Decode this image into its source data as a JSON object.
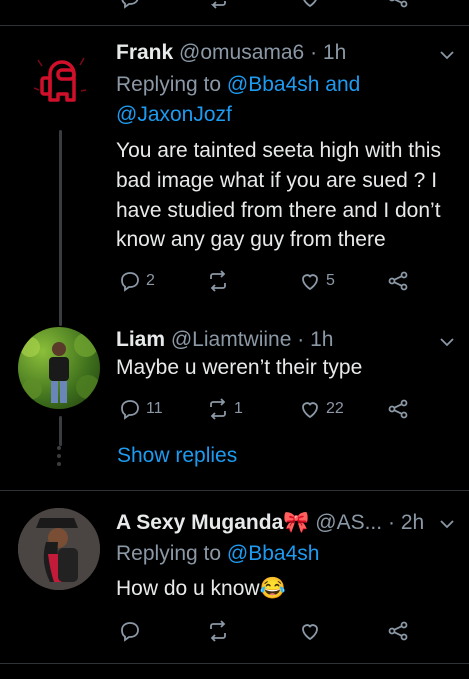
{
  "tweets": [
    {
      "name": "Frank",
      "handle": "@omusama6",
      "sep": "·",
      "time": "1h",
      "replying_prefix": "Replying to ",
      "replying_line1": "@Bba4sh and",
      "replying_line2": "@JaxonJozf",
      "text_lines": [
        "You are tainted seeta high with this",
        "bad image what if you are sued ? I",
        "have studied from there and I don’t",
        "know any gay guy from there"
      ],
      "replies": "2",
      "retweets": "",
      "likes": "5"
    },
    {
      "name": "Liam",
      "handle": "@Liamtwiine",
      "sep": "·",
      "time": "1h",
      "text_lines": [
        "Maybe u weren’t their type"
      ],
      "replies": "11",
      "retweets": "1",
      "likes": "22"
    },
    {
      "name": "A Sexy Muganda🎀",
      "handle": "@AS...",
      "sep": "·",
      "time": "2h",
      "replying_prefix": "Replying to ",
      "replying_line1": "@Bba4sh",
      "text_lines": [
        "How do u know😂"
      ],
      "replies": "",
      "retweets": "",
      "likes": ""
    }
  ],
  "show_replies": "Show replies",
  "icons": {
    "reply": "reply-icon",
    "retweet": "retweet-icon",
    "like": "heart-icon",
    "share": "share-icon",
    "more": "chevron-down-icon"
  },
  "colors": {
    "background": "#000000",
    "link": "#1d9bf0",
    "muted": "#8b98a5",
    "text": "#e7e9ea"
  }
}
